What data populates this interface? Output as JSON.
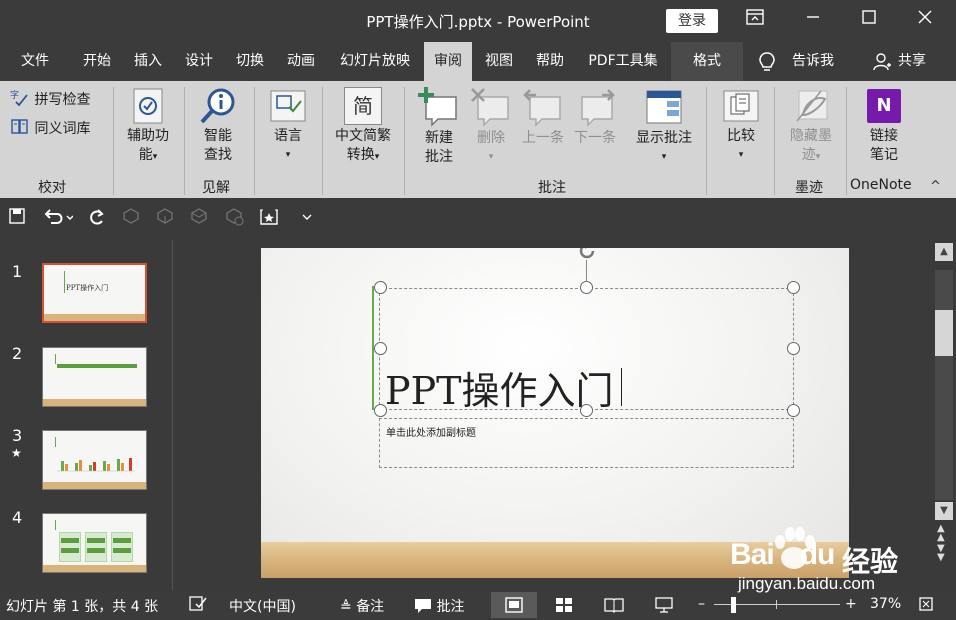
{
  "window": {
    "title": "PPT操作入门.pptx  -  PowerPoint",
    "login": "登录",
    "controls": [
      "restore-ribbon",
      "minimize",
      "maximize",
      "close"
    ]
  },
  "menu": {
    "tabs": [
      "文件",
      "开始",
      "插入",
      "设计",
      "切换",
      "动画",
      "幻灯片放映",
      "审阅",
      "视图",
      "帮助",
      "PDF工具集",
      "格式"
    ],
    "active": "审阅",
    "tell_me": "告诉我",
    "share": "共享"
  },
  "ribbon": {
    "proofing": {
      "spell": "拼写检查",
      "thesaurus": "同义词库",
      "group": "校对"
    },
    "accessibility": {
      "line1": "辅助功",
      "line2": "能",
      "arrow": "▾"
    },
    "insights": {
      "line1": "智能",
      "line2": "查找",
      "group": "见解"
    },
    "language": {
      "line1": "语言",
      "arrow": "▾"
    },
    "chinese": {
      "icon_char": "简",
      "line1": "中文简繁",
      "line2": "转换",
      "arrow": "▾"
    },
    "comments": {
      "new_line1": "新建",
      "new_line2": "批注",
      "delete": "删除",
      "delete_arrow": "▾",
      "prev": "上一条",
      "next": "下一条",
      "show_line1": "显示批注",
      "show_arrow": "▾",
      "group": "批注"
    },
    "compare": {
      "line1": "比较",
      "arrow": "▾"
    },
    "ink": {
      "line1": "隐藏墨",
      "line2": "迹",
      "arrow": "▾",
      "group": "墨迹"
    },
    "onenote": {
      "icon_char": "N",
      "line1": "链接",
      "line2": "笔记",
      "group": "OneNote"
    },
    "collapse": "^"
  },
  "slides": {
    "numbers": [
      "1",
      "2",
      "3",
      "4"
    ],
    "star": "★",
    "thumb1_title": "PPT操作入门"
  },
  "slide": {
    "title": "PPT操作入门",
    "subtitle": "单击此处添加副标题"
  },
  "status": {
    "slide_info": "幻灯片 第 1 张，共 4 张",
    "language": "中文(中国)",
    "notes": "备注",
    "comments": "批注",
    "zoom_minus": "–",
    "zoom_plus": "+",
    "zoom": "37%"
  },
  "watermark": {
    "brand_a": "Bai",
    "brand_b": "du",
    "brand_cn": "经验",
    "url": "jingyan.baidu.com"
  },
  "colors": {
    "accent": "#d35230",
    "title_line": "#6aa84f",
    "green_bar": "#5a9e3e",
    "onenote": "#7719aa"
  }
}
